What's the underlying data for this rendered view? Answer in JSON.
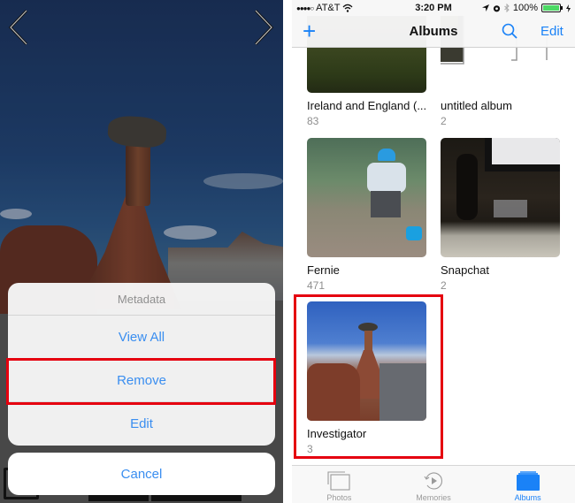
{
  "left_panel": {
    "nav": {
      "prev_icon": "chevron-left-icon",
      "next_icon": "chevron-right-icon"
    },
    "action_sheet": {
      "title": "Metadata",
      "items": [
        {
          "label": "View All"
        },
        {
          "label": "Remove",
          "highlighted": true
        },
        {
          "label": "Edit"
        }
      ],
      "cancel_label": "Cancel"
    },
    "accent_color": "#3a8ef0",
    "highlight_color": "#e5000f"
  },
  "right_panel": {
    "status_bar": {
      "signal": "●●●●○",
      "carrier": "AT&T",
      "time": "3:20 PM",
      "battery": "100%",
      "icons": [
        "wifi-icon",
        "location-icon",
        "alarm-icon",
        "bluetooth-icon",
        "battery-icon",
        "charging-icon"
      ]
    },
    "navbar": {
      "add_icon": "+",
      "title": "Albums",
      "search_icon": "search-icon",
      "edit_label": "Edit"
    },
    "albums": [
      {
        "name": "Ireland and England (...",
        "count": "83"
      },
      {
        "name": "untitled album",
        "count": "2"
      },
      {
        "name": "Fernie",
        "count": "471"
      },
      {
        "name": "Snapchat",
        "count": "2"
      },
      {
        "name": "Investigator",
        "count": "3",
        "highlighted": true
      }
    ],
    "tabbar": {
      "tabs": [
        {
          "label": "Photos",
          "icon": "photos-icon",
          "active": false
        },
        {
          "label": "Memories",
          "icon": "memories-icon",
          "active": false
        },
        {
          "label": "Albums",
          "icon": "albums-icon",
          "active": true
        }
      ]
    },
    "accent_color": "#1a82f7"
  }
}
